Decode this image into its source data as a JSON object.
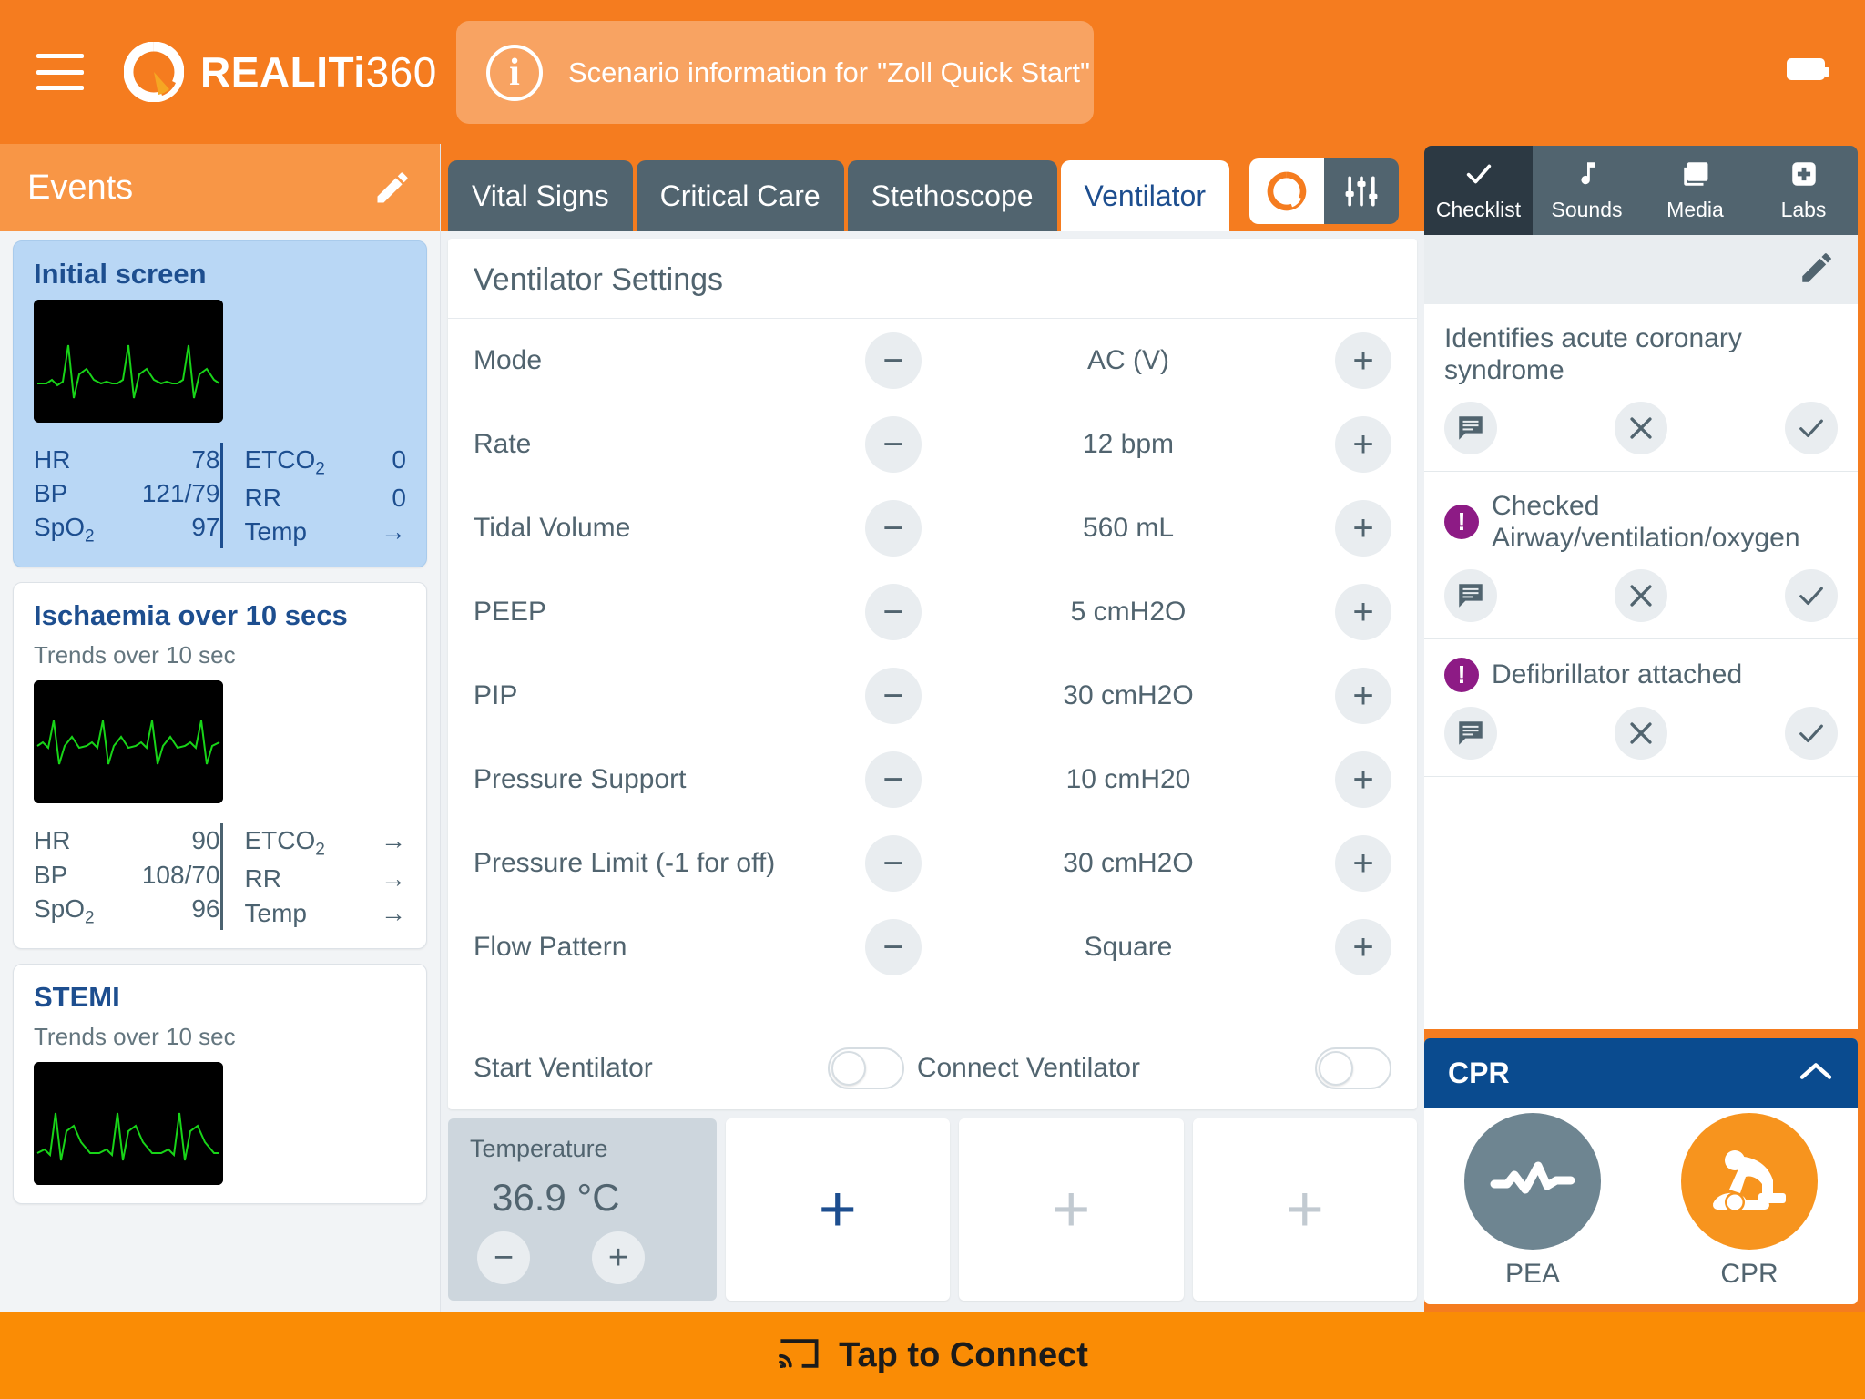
{
  "app": {
    "brand_bold": "REALITi",
    "brand_thin": "360",
    "menu_icon": "hamburger-icon",
    "battery_icon": "battery-icon"
  },
  "scenario_banner": {
    "info_icon": "info-icon",
    "prefix": "Scenario information for",
    "name": "\"Zoll Quick Start\""
  },
  "events": {
    "title": "Events",
    "edit_icon": "pencil-icon",
    "cards": [
      {
        "title": "Initial screen",
        "subtitle": "",
        "selected": true,
        "vitals_left": [
          {
            "label": "HR",
            "value": "78"
          },
          {
            "label": "BP",
            "value": "121/79"
          },
          {
            "label": "SpO",
            "sub": "2",
            "value": "97"
          }
        ],
        "vitals_right": [
          {
            "label": "ETCO",
            "sub": "2",
            "value": "0"
          },
          {
            "label": "RR",
            "value": "0"
          },
          {
            "label": "Temp",
            "value": "→"
          }
        ]
      },
      {
        "title": "Ischaemia over 10 secs",
        "subtitle": "Trends over 10 sec",
        "selected": false,
        "vitals_left": [
          {
            "label": "HR",
            "value": "90"
          },
          {
            "label": "BP",
            "value": "108/70"
          },
          {
            "label": "SpO",
            "sub": "2",
            "value": "96"
          }
        ],
        "vitals_right": [
          {
            "label": "ETCO",
            "sub": "2",
            "value": "→"
          },
          {
            "label": "RR",
            "value": "→"
          },
          {
            "label": "Temp",
            "value": "→"
          }
        ]
      },
      {
        "title": "STEMI",
        "subtitle": "Trends over 10 sec",
        "selected": false,
        "vitals_left": [],
        "vitals_right": []
      }
    ]
  },
  "center": {
    "tabs": [
      {
        "label": "Vital Signs",
        "active": false
      },
      {
        "label": "Critical Care",
        "active": false
      },
      {
        "label": "Stethoscope",
        "active": false
      },
      {
        "label": "Ventilator",
        "active": true
      }
    ],
    "tools": [
      {
        "name": "realiti-logo-button",
        "style": "light"
      },
      {
        "name": "sliders-settings-button",
        "style": "dark"
      }
    ],
    "panel_title": "Ventilator Settings",
    "settings": [
      {
        "label": "Mode",
        "value": "AC (V)"
      },
      {
        "label": "Rate",
        "value": "12 bpm"
      },
      {
        "label": "Tidal Volume",
        "value": "560 mL"
      },
      {
        "label": "PEEP",
        "value": "5 cmH2O"
      },
      {
        "label": "PIP",
        "value": "30 cmH2O"
      },
      {
        "label": "Pressure Support",
        "value": "10 cmH20"
      },
      {
        "label": "Pressure Limit (-1 for off)",
        "value": "30 cmH2O"
      },
      {
        "label": "Flow Pattern",
        "value": "Square"
      }
    ],
    "decrement_glyph": "−",
    "increment_glyph": "+",
    "toggles": [
      {
        "label": "Start Ventilator",
        "on": false
      },
      {
        "label": "Connect Ventilator",
        "on": false
      }
    ],
    "tiles": {
      "temperature": {
        "label": "Temperature",
        "value": "36.9 °C",
        "minus": "−",
        "plus": "+"
      },
      "add_tiles": [
        {
          "glyph": "+",
          "accent": true
        },
        {
          "glyph": "+",
          "accent": false
        },
        {
          "glyph": "+",
          "accent": false
        }
      ]
    }
  },
  "right_panel": {
    "tabs": [
      {
        "label": "Checklist",
        "icon": "check-icon",
        "active": true
      },
      {
        "label": "Sounds",
        "icon": "music-note-icon",
        "active": false
      },
      {
        "label": "Media",
        "icon": "image-icon",
        "active": false
      },
      {
        "label": "Labs",
        "icon": "plus-square-icon",
        "active": false
      }
    ],
    "edit_icon": "pencil-icon",
    "checklist": [
      {
        "text": "Identifies acute coronary syndrome",
        "warn": false
      },
      {
        "text": "Checked Airway/ventilation/oxygen",
        "warn": true
      },
      {
        "text": "Defibrillator attached",
        "warn": true
      }
    ],
    "checklist_actions": {
      "comment": "comment-icon",
      "reject": "x-icon",
      "accept": "check-icon"
    },
    "cpr": {
      "title": "CPR",
      "collapse_icon": "chevron-up-icon",
      "items": [
        {
          "label": "PEA",
          "icon": "waveform-icon",
          "color": "#6E8591"
        },
        {
          "label": "CPR",
          "icon": "cpr-person-icon",
          "color": "#F7941E"
        }
      ]
    }
  },
  "footer": {
    "icon": "cast-connect-icon",
    "label": "Tap to Connect"
  },
  "colors": {
    "orange": "#F57C1F",
    "orange_light": "#F89646",
    "slate": "#51646F",
    "blue": "#1d4e8f",
    "cpr_blue": "#0A4B8F",
    "purple": "#8D1B85",
    "ecg_green": "#18d418"
  }
}
